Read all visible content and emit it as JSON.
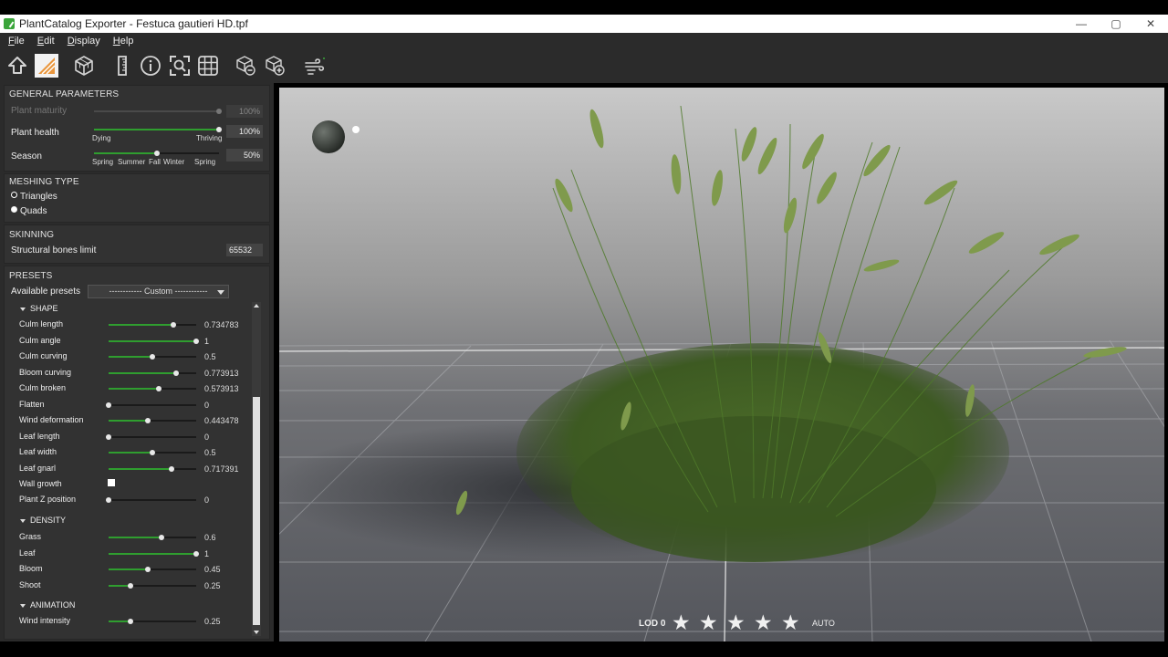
{
  "window": {
    "title": "PlantCatalog Exporter - Festuca gautieri HD.tpf"
  },
  "window_controls": {
    "minimize": "—",
    "maximize": "▢",
    "close": "✕"
  },
  "menu": [
    "File",
    "Edit",
    "Display",
    "Help"
  ],
  "toolbar": {
    "icons": [
      "upload-arrow-icon",
      "material-swatch-icon",
      "cube-icon",
      "ruler-icon",
      "info-icon",
      "focus-frame-icon",
      "grid-icon",
      "lod-minus-icon",
      "lod-plus-icon",
      "wind-icon"
    ]
  },
  "general": {
    "title": "GENERAL PARAMETERS",
    "maturity": {
      "label": "Plant maturity",
      "value": "100%",
      "fraction": 1.0,
      "enabled": false
    },
    "health": {
      "label": "Plant health",
      "value": "100%",
      "fraction": 1.0,
      "min_label": "Dying",
      "max_label": "Thriving"
    },
    "season": {
      "label": "Season",
      "value": "50%",
      "fraction": 0.5,
      "ticks": [
        "Spring",
        "Summer",
        "Fall",
        "Winter",
        "Spring"
      ]
    }
  },
  "meshing": {
    "title": "MESHING TYPE",
    "options": [
      "Triangles",
      "Quads"
    ],
    "selected": "Triangles"
  },
  "skinning": {
    "title": "SKINNING",
    "bones_label": "Structural bones limit",
    "bones_value": "65532"
  },
  "presets": {
    "title": "PRESETS",
    "available_label": "Available presets",
    "selected": "------------ Custom ------------",
    "groups": {
      "shape": {
        "title": "SHAPE",
        "params": [
          {
            "label": "Culm length",
            "value": "0.734783",
            "fraction": 0.734783
          },
          {
            "label": "Culm angle",
            "value": "1",
            "fraction": 1.0
          },
          {
            "label": "Culm curving",
            "value": "0.5",
            "fraction": 0.5
          },
          {
            "label": "Bloom curving",
            "value": "0.773913",
            "fraction": 0.773913
          },
          {
            "label": "Culm broken",
            "value": "0.573913",
            "fraction": 0.573913
          },
          {
            "label": "Flatten",
            "value": "0",
            "fraction": 0
          },
          {
            "label": "Wind deformation",
            "value": "0.443478",
            "fraction": 0.443478
          },
          {
            "label": "Leaf length",
            "value": "0",
            "fraction": 0
          },
          {
            "label": "Leaf width",
            "value": "0.5",
            "fraction": 0.5
          },
          {
            "label": "Leaf gnarl",
            "value": "0.717391",
            "fraction": 0.717391
          }
        ],
        "wall_growth": {
          "label": "Wall growth",
          "checked": true
        },
        "plant_z": {
          "label": "Plant Z position",
          "value": "0",
          "fraction": 0
        }
      },
      "density": {
        "title": "DENSITY",
        "params": [
          {
            "label": "Grass",
            "value": "0.6",
            "fraction": 0.6
          },
          {
            "label": "Leaf",
            "value": "1",
            "fraction": 1.0
          },
          {
            "label": "Bloom",
            "value": "0.45",
            "fraction": 0.45
          },
          {
            "label": "Shoot",
            "value": "0.25",
            "fraction": 0.25
          }
        ]
      },
      "animation": {
        "title": "ANIMATION",
        "params": [
          {
            "label": "Wind intensity",
            "value": "0.25",
            "fraction": 0.25
          }
        ]
      }
    }
  },
  "viewport": {
    "lod_label": "LOD 0",
    "stars": [
      "★",
      "★",
      "★",
      "★",
      "★"
    ],
    "auto_label": "AUTO"
  },
  "colors": {
    "accent_green": "#2f9e2f",
    "panel_bg": "#2b2b2b",
    "section_bg": "#323232"
  }
}
